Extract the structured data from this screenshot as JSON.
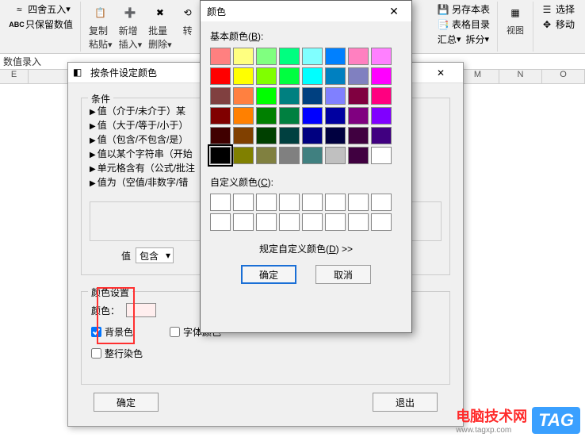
{
  "ribbon": {
    "round_label": "四舍五入",
    "keep_num_label": "只保留数值",
    "copy_label": "复制",
    "paste_label": "粘贴",
    "insert_label": "新增",
    "insert_sub": "插入",
    "batch_label": "批量",
    "delete_label": "删除",
    "turn_label": "转",
    "saveas_label": "另存本表",
    "tbllist_label": "表格目录",
    "summary_label": "汇总",
    "split_label": "拆分",
    "view_label": "视图",
    "select_label": "选择",
    "move_label": "移动"
  },
  "formula_bar": {
    "label": "数值录入"
  },
  "columns": [
    "E",
    "M",
    "N",
    "O"
  ],
  "dialog1": {
    "title": "按条件设定颜色",
    "group_condition": "条件",
    "conditions": [
      "值（介于/未介于）某",
      "值（大于/等于/小于）",
      "值（包含/不包含/是）",
      "值以某个字符串（开始",
      "单元格含有（公式/批注",
      "值为（空值/非数字/错"
    ],
    "value_label": "值",
    "contain_option": "包含",
    "group_colorset": "颜色设置",
    "color_label": "颜色：",
    "bg_check": "背景色",
    "font_check": "字体颜色",
    "wholerow_check": "整行染色",
    "ok": "确定",
    "exit": "退出",
    "min_icon": "—",
    "close_icon": "✕"
  },
  "dialog2": {
    "title": "颜色",
    "basic_label_pre": "基本颜色(",
    "basic_label_key": "B",
    "basic_label_post": "):",
    "custom_label_pre": "自定义颜色(",
    "custom_label_key": "C",
    "custom_label_post": "):",
    "define_label_pre": "规定自定义颜色(",
    "define_label_key": "D",
    "define_label_post": ") >>",
    "ok": "确定",
    "cancel": "取消",
    "close_icon": "✕",
    "basic_colors": [
      "#ff8080",
      "#ffff80",
      "#80ff80",
      "#00ff80",
      "#80ffff",
      "#0080ff",
      "#ff80c0",
      "#ff80ff",
      "#ff0000",
      "#ffff00",
      "#80ff00",
      "#00ff40",
      "#00ffff",
      "#0080c0",
      "#8080c0",
      "#ff00ff",
      "#804040",
      "#ff8040",
      "#00ff00",
      "#008080",
      "#004080",
      "#8080ff",
      "#800040",
      "#ff0080",
      "#800000",
      "#ff8000",
      "#008000",
      "#008040",
      "#0000ff",
      "#0000a0",
      "#800080",
      "#8000ff",
      "#400000",
      "#804000",
      "#004000",
      "#004040",
      "#000080",
      "#000040",
      "#400040",
      "#400080",
      "#000000",
      "#808000",
      "#808040",
      "#808080",
      "#408080",
      "#c0c0c0",
      "#400040",
      "#ffffff"
    ],
    "selected_index": 40
  },
  "watermark": {
    "text": "电脑技术网",
    "url": "www.tagxp.com",
    "tag": "TAG"
  }
}
